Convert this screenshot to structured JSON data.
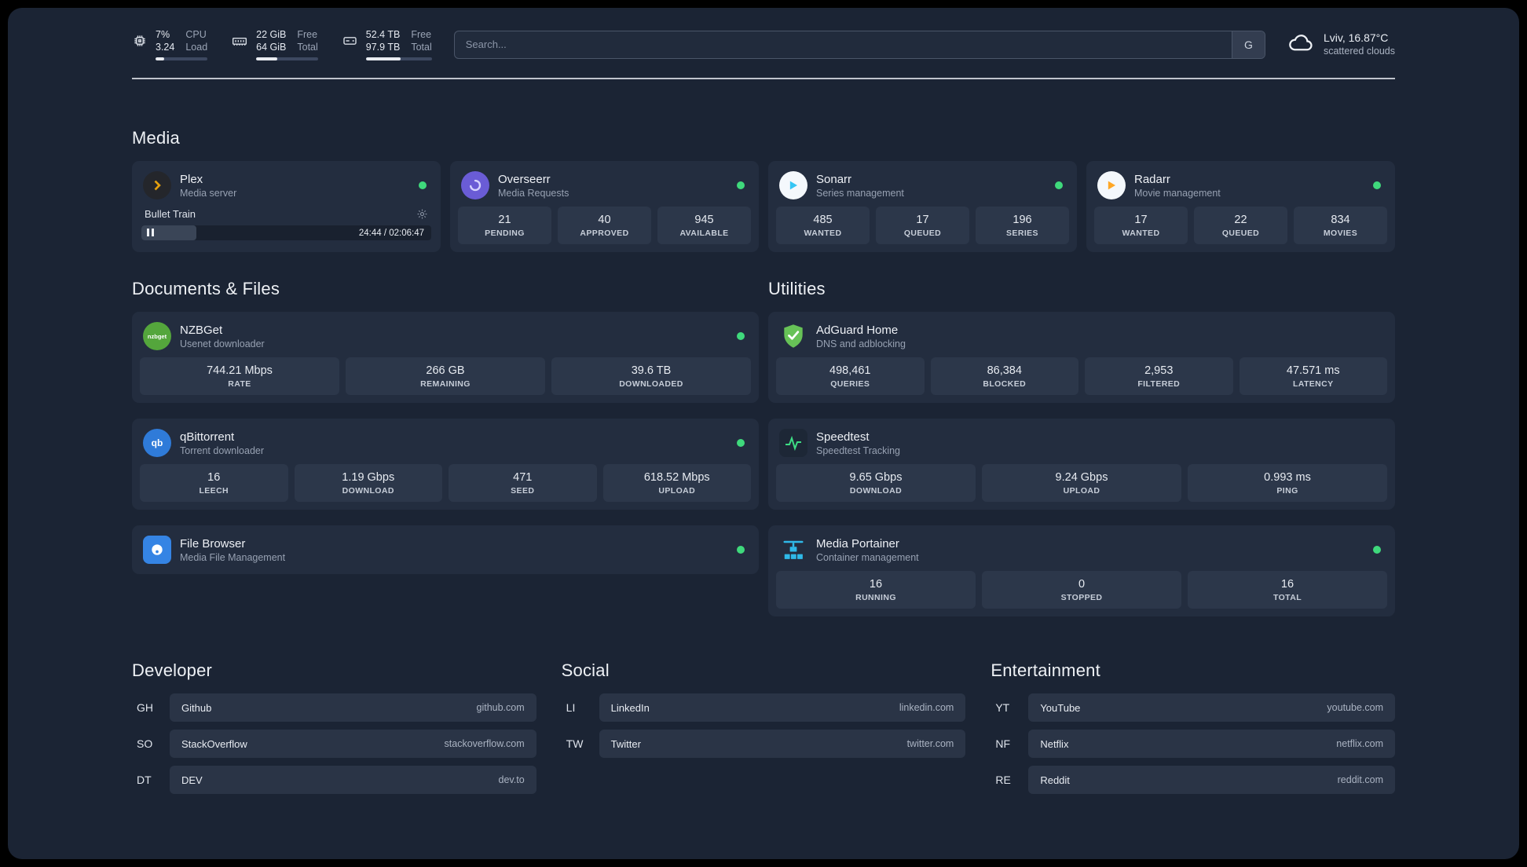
{
  "topbar": {
    "cpu": {
      "value_top": "7%",
      "value_bottom": "3.24",
      "label_top": "CPU",
      "label_bottom": "Load",
      "progress": 16
    },
    "ram": {
      "value_top": "22 GiB",
      "value_bottom": "64 GiB",
      "label_top": "Free",
      "label_bottom": "Total",
      "progress": 34
    },
    "disk": {
      "value_top": "52.4 TB",
      "value_bottom": "97.9 TB",
      "label_top": "Free",
      "label_bottom": "Total",
      "progress": 53
    },
    "search": {
      "placeholder": "Search...",
      "provider": "G"
    },
    "weather": {
      "location": "Lviv, 16.87°C",
      "condition": "scattered clouds"
    }
  },
  "media": {
    "heading": "Media",
    "plex": {
      "name": "Plex",
      "desc": "Media server",
      "now_playing": "Bullet Train",
      "time": "24:44 / 02:06:47",
      "progress": 19
    },
    "overseerr": {
      "name": "Overseerr",
      "desc": "Media Requests",
      "stats": [
        {
          "value": "21",
          "label": "PENDING"
        },
        {
          "value": "40",
          "label": "APPROVED"
        },
        {
          "value": "945",
          "label": "AVAILABLE"
        }
      ]
    },
    "sonarr": {
      "name": "Sonarr",
      "desc": "Series management",
      "stats": [
        {
          "value": "485",
          "label": "WANTED"
        },
        {
          "value": "17",
          "label": "QUEUED"
        },
        {
          "value": "196",
          "label": "SERIES"
        }
      ]
    },
    "radarr": {
      "name": "Radarr",
      "desc": "Movie management",
      "stats": [
        {
          "value": "17",
          "label": "WANTED"
        },
        {
          "value": "22",
          "label": "QUEUED"
        },
        {
          "value": "834",
          "label": "MOVIES"
        }
      ]
    }
  },
  "documents": {
    "heading": "Documents & Files",
    "nzbget": {
      "name": "NZBGet",
      "desc": "Usenet downloader",
      "icon_text": "nzbget",
      "stats": [
        {
          "value": "744.21 Mbps",
          "label": "RATE"
        },
        {
          "value": "266 GB",
          "label": "REMAINING"
        },
        {
          "value": "39.6 TB",
          "label": "DOWNLOADED"
        }
      ]
    },
    "qbittorrent": {
      "name": "qBittorrent",
      "desc": "Torrent downloader",
      "icon_text": "qb",
      "stats": [
        {
          "value": "16",
          "label": "LEECH"
        },
        {
          "value": "1.19 Gbps",
          "label": "DOWNLOAD"
        },
        {
          "value": "471",
          "label": "SEED"
        },
        {
          "value": "618.52 Mbps",
          "label": "UPLOAD"
        }
      ]
    },
    "filebrowser": {
      "name": "File Browser",
      "desc": "Media File Management"
    }
  },
  "utilities": {
    "heading": "Utilities",
    "adguard": {
      "name": "AdGuard Home",
      "desc": "DNS and adblocking",
      "stats": [
        {
          "value": "498,461",
          "label": "QUERIES"
        },
        {
          "value": "86,384",
          "label": "BLOCKED"
        },
        {
          "value": "2,953",
          "label": "FILTERED"
        },
        {
          "value": "47.571 ms",
          "label": "LATENCY"
        }
      ]
    },
    "speedtest": {
      "name": "Speedtest",
      "desc": "Speedtest Tracking",
      "stats": [
        {
          "value": "9.65 Gbps",
          "label": "DOWNLOAD"
        },
        {
          "value": "9.24 Gbps",
          "label": "UPLOAD"
        },
        {
          "value": "0.993 ms",
          "label": "PING"
        }
      ]
    },
    "portainer": {
      "name": "Media Portainer",
      "desc": "Container management",
      "stats": [
        {
          "value": "16",
          "label": "RUNNING"
        },
        {
          "value": "0",
          "label": "STOPPED"
        },
        {
          "value": "16",
          "label": "TOTAL"
        }
      ]
    }
  },
  "bookmarks": {
    "developer": {
      "heading": "Developer",
      "items": [
        {
          "abbr": "GH",
          "name": "Github",
          "url": "github.com"
        },
        {
          "abbr": "SO",
          "name": "StackOverflow",
          "url": "stackoverflow.com"
        },
        {
          "abbr": "DT",
          "name": "DEV",
          "url": "dev.to"
        }
      ]
    },
    "social": {
      "heading": "Social",
      "items": [
        {
          "abbr": "LI",
          "name": "LinkedIn",
          "url": "linkedin.com"
        },
        {
          "abbr": "TW",
          "name": "Twitter",
          "url": "twitter.com"
        }
      ]
    },
    "entertainment": {
      "heading": "Entertainment",
      "items": [
        {
          "abbr": "YT",
          "name": "YouTube",
          "url": "youtube.com"
        },
        {
          "abbr": "NF",
          "name": "Netflix",
          "url": "netflix.com"
        },
        {
          "abbr": "RE",
          "name": "Reddit",
          "url": "reddit.com"
        }
      ]
    }
  },
  "colors": {
    "status_online": "#3fd97c",
    "plex": "#e5a00d",
    "overseerr": "#7a5cd6",
    "sonarr": "#35c5f4",
    "radarr": "#ffa726",
    "nzbget": "#5dbb46",
    "qbittorrent": "#3daee9",
    "adguard": "#67c257",
    "speedtest": "#3ddc84",
    "filebrowser": "#3584e4",
    "portainer": "#2fb9e8"
  }
}
